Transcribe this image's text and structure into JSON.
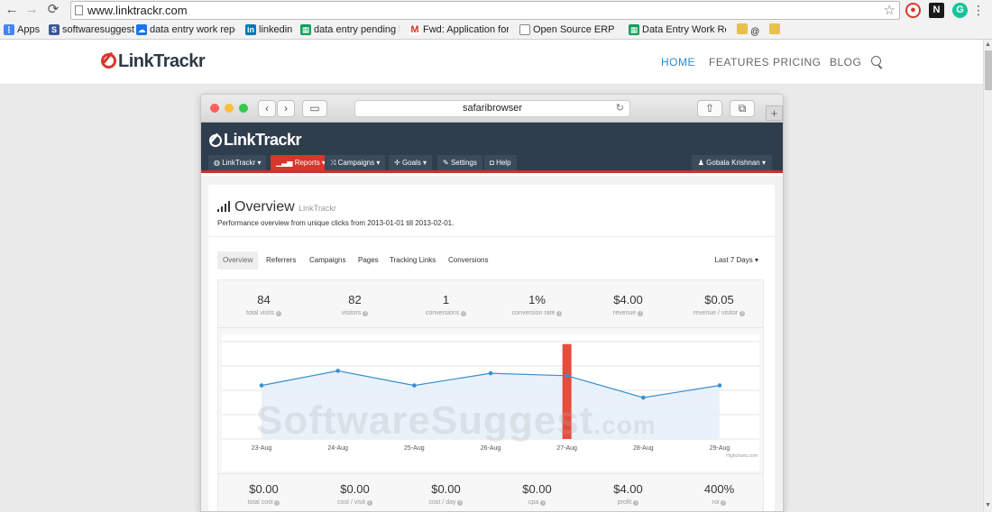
{
  "browser": {
    "url": "www.linktrackr.com",
    "bookmarks": [
      {
        "label": "Apps",
        "color": "#4285f4"
      },
      {
        "label": "softwaresuggest",
        "color": "#3b5998"
      },
      {
        "label": "data entry work repo",
        "color": "#1a73e8"
      },
      {
        "label": "linkedin",
        "color": "#0077b5"
      },
      {
        "label": "data entry pending lis",
        "color": "#0f9d58"
      },
      {
        "label": "Fwd: Application for H",
        "color": "#d93025"
      },
      {
        "label": "Open Source ERP for",
        "color": "#777777"
      },
      {
        "label": "Data Entry Work Repo",
        "color": "#0f9d58"
      }
    ]
  },
  "site": {
    "logo": "LinkTrackr",
    "nav": [
      "HOME",
      "FEATURES",
      "PRICING",
      "BLOG"
    ]
  },
  "safari": {
    "url": "safaribrowser"
  },
  "app": {
    "logo": "LinkTrackr",
    "nav": [
      "LinkTrackr ▾",
      "Reports ▾",
      "Campaigns ▾",
      "Goals ▾",
      "Settings",
      "Help"
    ],
    "user": "Gobala Krishnan ▾"
  },
  "overview": {
    "title": "Overview",
    "subtitle": "LinkTrackr",
    "description": "Performance overview from unique clicks from 2013-01-01 till 2013-02-01.",
    "tabs": [
      "Overview",
      "Referrers",
      "Campaigns",
      "Pages",
      "Tracking Links",
      "Conversions"
    ],
    "range": "Last 7 Days ▾",
    "stats_top": [
      {
        "value": "84",
        "label": "total visits"
      },
      {
        "value": "82",
        "label": "visitors"
      },
      {
        "value": "1",
        "label": "conversions"
      },
      {
        "value": "1%",
        "label": "conversion rate"
      },
      {
        "value": "$4.00",
        "label": "revenue"
      },
      {
        "value": "$0.05",
        "label": "revenue / visitor"
      }
    ],
    "stats_bottom": [
      {
        "value": "$0.00",
        "label": "total cost"
      },
      {
        "value": "$0.00",
        "label": "cost / visit"
      },
      {
        "value": "$0.00",
        "label": "cost / day"
      },
      {
        "value": "$0.00",
        "label": "cpa"
      },
      {
        "value": "$4.00",
        "label": "profit"
      },
      {
        "value": "400%",
        "label": "roi"
      }
    ],
    "credit": "Highcharts.com"
  },
  "watermark": {
    "main": "SoftwareSuggest",
    "suffix": ".com"
  },
  "chart_data": {
    "type": "line",
    "categories": [
      "23-Aug",
      "24-Aug",
      "25-Aug",
      "26-Aug",
      "27-Aug",
      "28-Aug",
      "29-Aug"
    ],
    "series": [
      {
        "values": [
          11,
          14,
          11,
          13.5,
          13,
          8.5,
          11
        ]
      },
      {
        "values": [
          0,
          0,
          0,
          0,
          1,
          0,
          0
        ]
      }
    ],
    "colors": {
      "line": "#3a8fd0",
      "area": "#e3eff9",
      "bar": "#e74c3c"
    },
    "ylim": [
      0,
      20
    ],
    "grid": true
  }
}
